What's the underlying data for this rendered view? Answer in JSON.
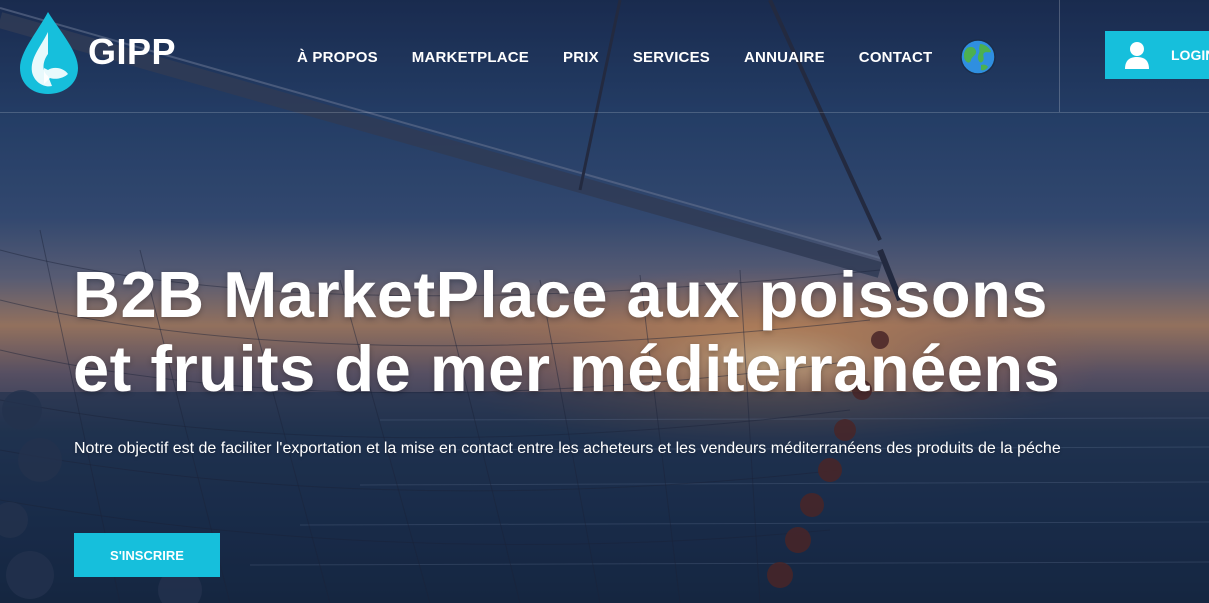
{
  "brand": {
    "name": "GIPP",
    "logo_icon": "water-drop-fish-icon"
  },
  "nav": {
    "items": [
      {
        "label": "À PROPOS"
      },
      {
        "label": "MARKETPLACE"
      },
      {
        "label": "PRIX"
      },
      {
        "label": "SERVICES"
      },
      {
        "label": "ANNUAIRE"
      },
      {
        "label": "CONTACT"
      }
    ],
    "language_icon": "globe-icon"
  },
  "login": {
    "label": "LOGIN",
    "icon": "user-icon"
  },
  "hero": {
    "title_line1": "B2B MarketPlace aux poissons",
    "title_line2": "et fruits de mer méditerranéens",
    "subtitle": "Notre objectif est de faciliter l'exportation et la mise en contact entre les acheteurs et les vendeurs méditerranéens des produits de la péche",
    "cta_label": "S'INSCRIRE"
  },
  "colors": {
    "accent": "#16bfdc",
    "text": "#ffffff"
  }
}
